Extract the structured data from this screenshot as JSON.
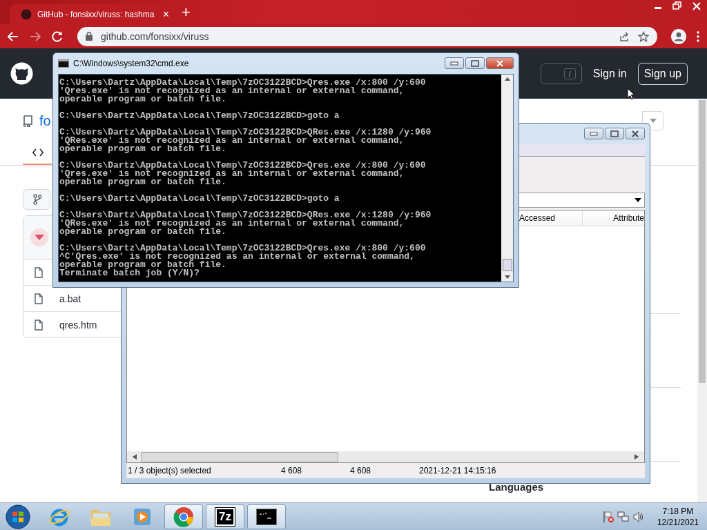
{
  "browser": {
    "tab": {
      "title": "GitHub - fonsixx/viruss: hashma",
      "close": "×"
    },
    "new_tab": "+",
    "forward_enabled": false,
    "url": "github.com/fonsixx/viruss"
  },
  "github": {
    "search_key": "/",
    "sign_in": "Sign in",
    "sign_up": "Sign up",
    "repo_name": "fo",
    "files": [
      {
        "name": "a.bat"
      },
      {
        "name": "qres.htm"
      }
    ],
    "languages_heading": "Languages"
  },
  "cmd": {
    "title": "C:\\Windows\\system32\\cmd.exe",
    "blocks": [
      [
        "C:\\Users\\Dartz\\AppData\\Local\\Temp\\7zOC3122BCD>Qres.exe /x:800 /y:600",
        "'Qres.exe' is not recognized as an internal or external command,",
        "operable program or batch file."
      ],
      [
        "C:\\Users\\Dartz\\AppData\\Local\\Temp\\7zOC3122BCD>goto a"
      ],
      [
        "C:\\Users\\Dartz\\AppData\\Local\\Temp\\7zOC3122BCD>QRes.exe /x:1280 /y:960",
        "'QRes.exe' is not recognized as an internal or external command,",
        "operable program or batch file."
      ],
      [
        "C:\\Users\\Dartz\\AppData\\Local\\Temp\\7zOC3122BCD>Qres.exe /x:800 /y:600",
        "'Qres.exe' is not recognized as an internal or external command,",
        "operable program or batch file."
      ],
      [
        "C:\\Users\\Dartz\\AppData\\Local\\Temp\\7zOC3122BCD>goto a"
      ],
      [
        "C:\\Users\\Dartz\\AppData\\Local\\Temp\\7zOC3122BCD>QRes.exe /x:1280 /y:960",
        "'QRes.exe' is not recognized as an internal or external command,",
        "operable program or batch file."
      ],
      [
        "C:\\Users\\Dartz\\AppData\\Local\\Temp\\7zOC3122BCD>Qres.exe /x:800 /y:600",
        "^C'Qres.exe' is not recognized as an internal or external command,",
        "operable program or batch file.",
        "Terminate batch job (Y/N)?"
      ]
    ]
  },
  "sevenzip": {
    "columns": [
      "Accessed",
      "Attribute"
    ],
    "status": [
      "1 / 3 object(s) selected",
      "4 608",
      "4 608",
      "2021-12-21 14:15:16"
    ]
  },
  "taskbar": {
    "items": [
      {
        "kind": "ie",
        "open": false
      },
      {
        "kind": "explorer",
        "open": false
      },
      {
        "kind": "media",
        "open": false
      },
      {
        "kind": "chrome",
        "open": true
      },
      {
        "kind": "sevenzip",
        "open": true,
        "label": "7z"
      },
      {
        "kind": "cmd",
        "open": true
      }
    ],
    "clock": {
      "time": "7:18 PM",
      "date": "12/21/2021"
    }
  }
}
